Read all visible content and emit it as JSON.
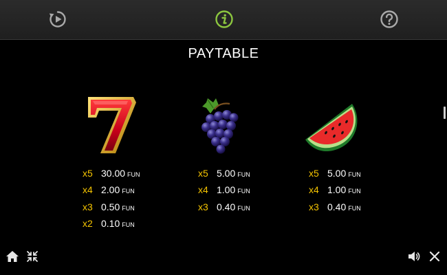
{
  "topbar": {
    "history_icon": "history-replay-icon",
    "info_icon": "info-icon",
    "help_icon": "help-question-icon",
    "active_color": "#8cc63f"
  },
  "title": "PAYTABLE",
  "symbols": [
    {
      "icon": "seven-icon",
      "pays": [
        {
          "mult": "x5",
          "amount": "30.00",
          "currency": "FUN"
        },
        {
          "mult": "x4",
          "amount": "2.00",
          "currency": "FUN"
        },
        {
          "mult": "x3",
          "amount": "0.50",
          "currency": "FUN"
        },
        {
          "mult": "x2",
          "amount": "0.10",
          "currency": "FUN"
        }
      ]
    },
    {
      "icon": "grapes-icon",
      "pays": [
        {
          "mult": "x5",
          "amount": "5.00",
          "currency": "FUN"
        },
        {
          "mult": "x4",
          "amount": "1.00",
          "currency": "FUN"
        },
        {
          "mult": "x3",
          "amount": "0.40",
          "currency": "FUN"
        }
      ]
    },
    {
      "icon": "watermelon-icon",
      "pays": [
        {
          "mult": "x5",
          "amount": "5.00",
          "currency": "FUN"
        },
        {
          "mult": "x4",
          "amount": "1.00",
          "currency": "FUN"
        },
        {
          "mult": "x3",
          "amount": "0.40",
          "currency": "FUN"
        }
      ]
    }
  ],
  "bottombar": {
    "home_icon": "home-icon",
    "collapse_icon": "collapse-icon",
    "sound_icon": "sound-icon",
    "close_icon": "close-icon"
  },
  "colors": {
    "multiplier": "#f5c400",
    "background": "#000000"
  }
}
